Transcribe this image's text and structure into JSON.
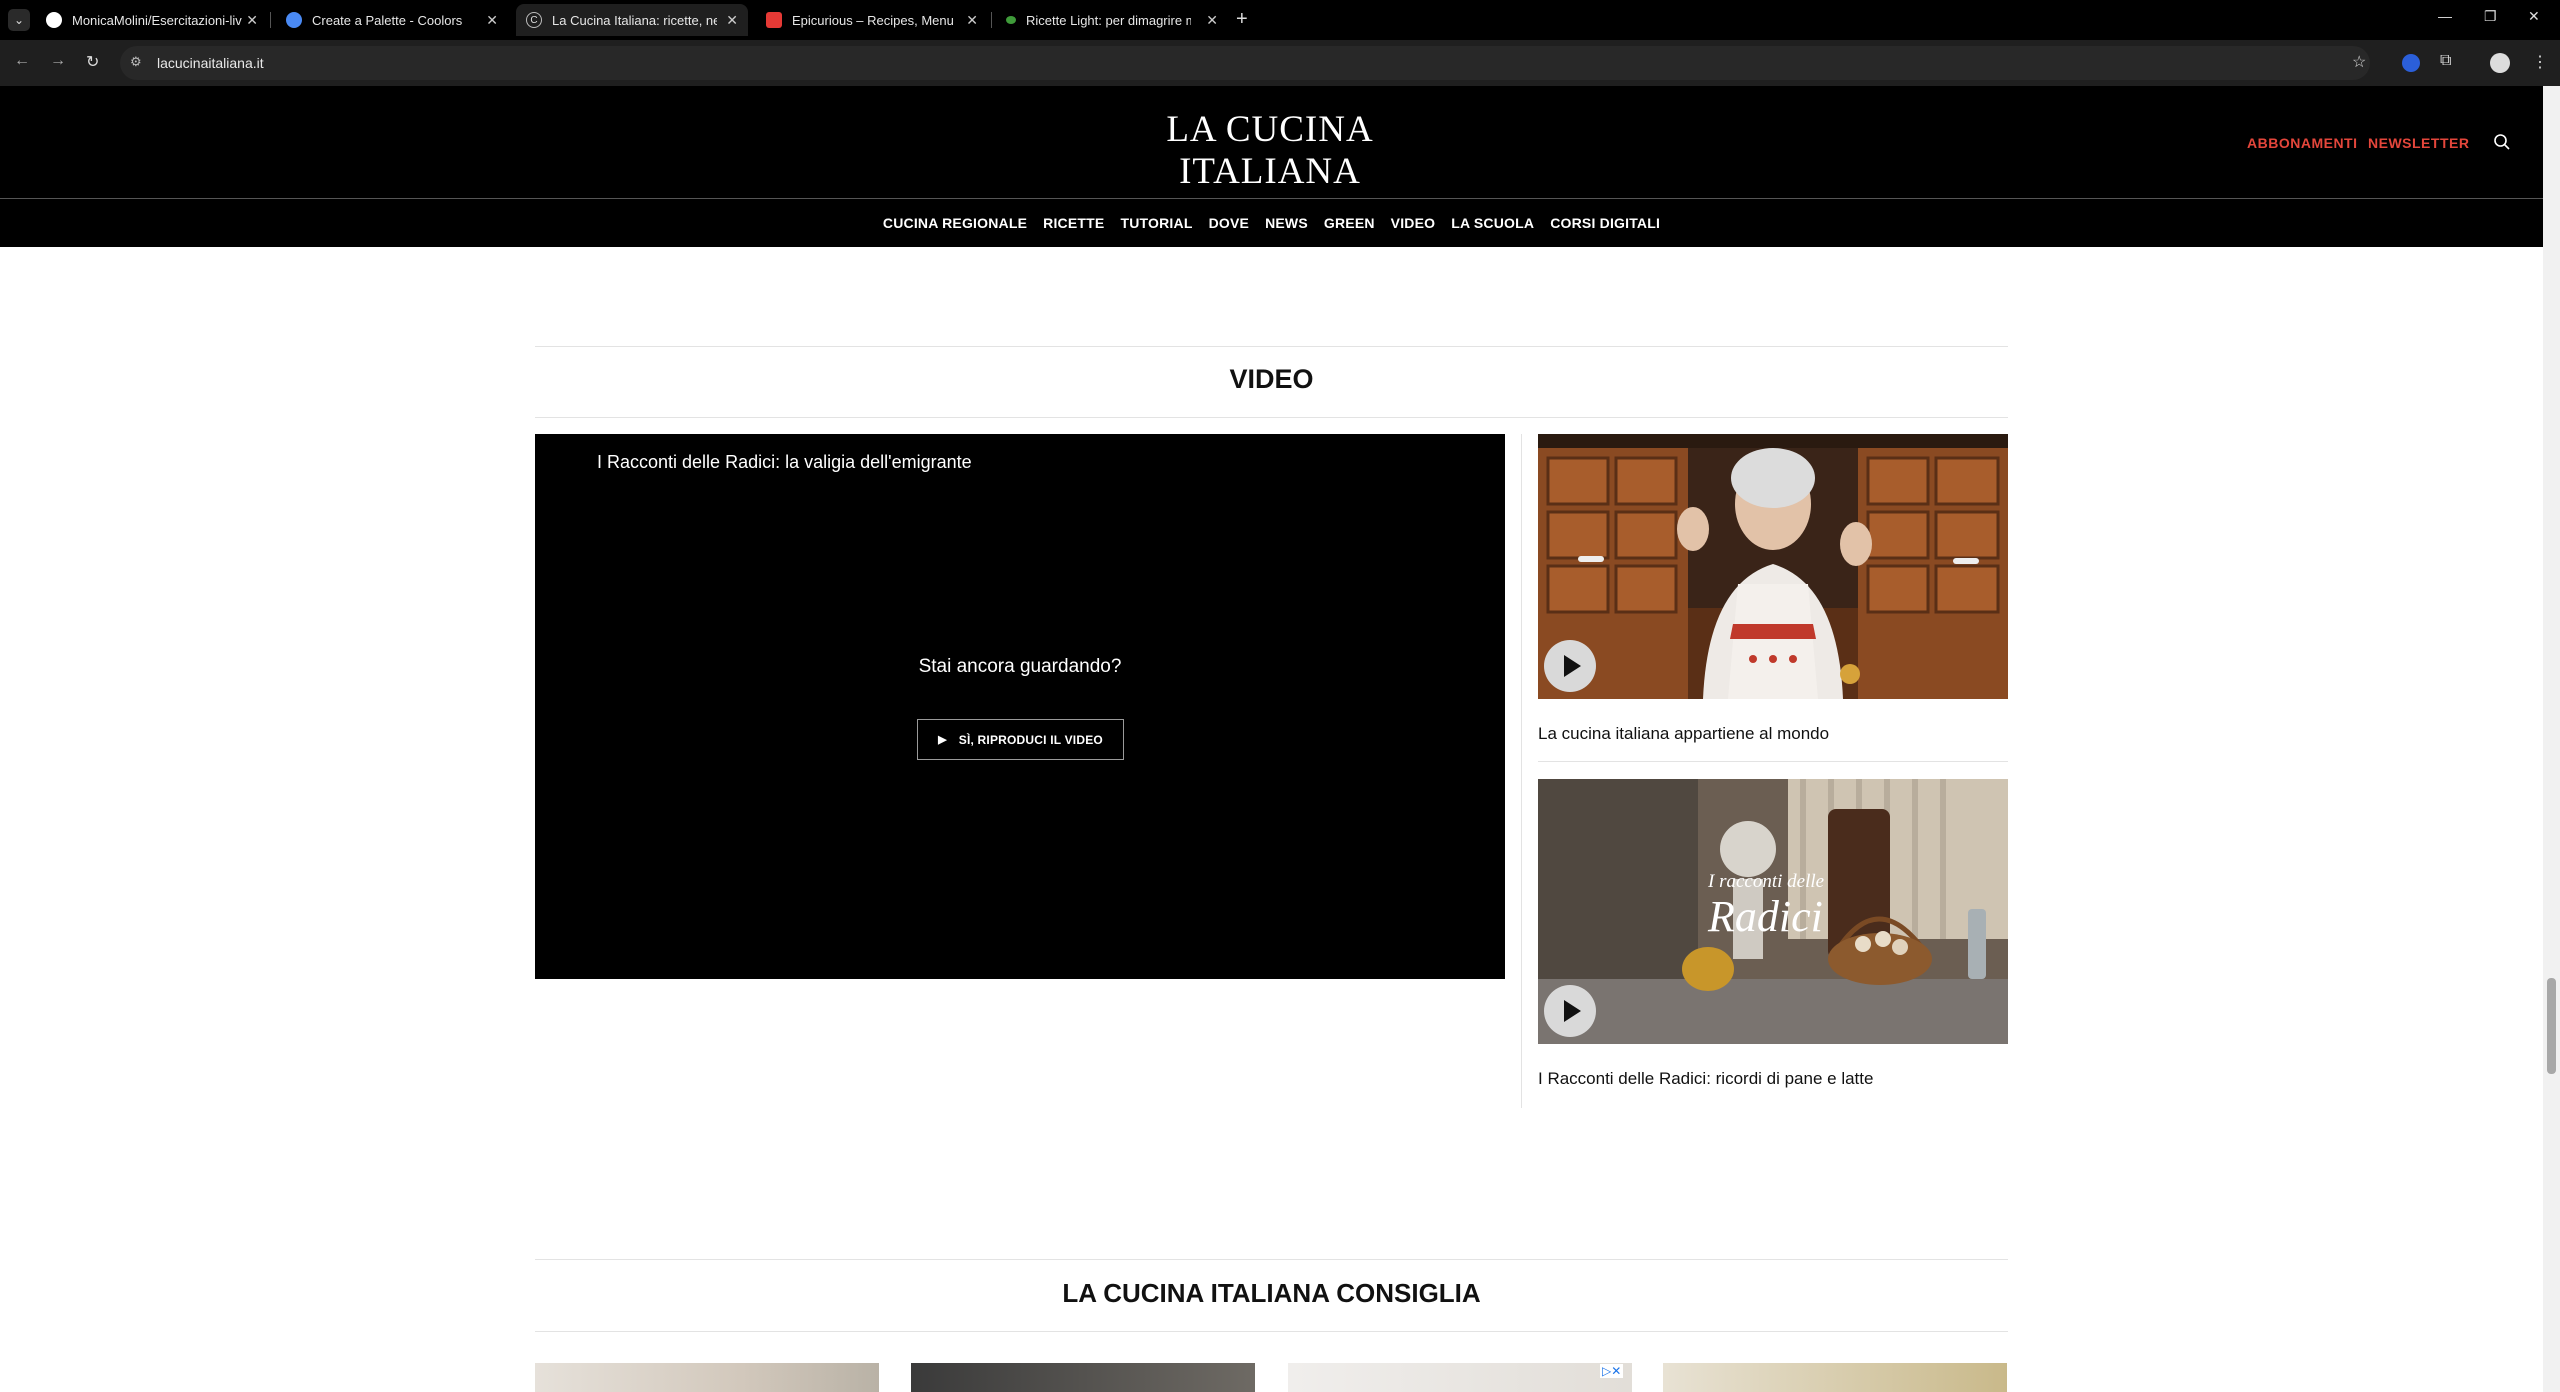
{
  "browser": {
    "tabs": [
      {
        "title": "MonicaMolini/Esercitazioni-live",
        "favicon": "github-icon"
      },
      {
        "title": "Create a Palette - Coolors",
        "favicon": "coolors-icon"
      },
      {
        "title": "La Cucina Italiana: ricette, news",
        "favicon": "lci-icon"
      },
      {
        "title": "Epicurious – Recipes, Menu Ide",
        "favicon": "epicurious-icon"
      },
      {
        "title": "Ricette Light: per dimagrire ma",
        "favicon": "leaf-icon"
      }
    ],
    "active_tab": 2,
    "url": "lacucinaitaliana.it"
  },
  "site": {
    "logo_line1": "LA CUCINA",
    "logo_line2": "ITALIANA",
    "header_links": [
      "ABBONAMENTI",
      "NEWSLETTER"
    ],
    "nav": [
      "CUCINA REGIONALE",
      "RICETTE",
      "TUTORIAL",
      "DOVE",
      "NEWS",
      "GREEN",
      "VIDEO",
      "LA SCUOLA",
      "CORSI DIGITALI"
    ],
    "accent_color": "#e4463b"
  },
  "video_section": {
    "title": "VIDEO",
    "player": {
      "title": "I Racconti delle Radici: la valigia dell'emigrante",
      "prompt": "Stai ancora guardando?",
      "replay_label": "SÌ, RIPRODUCI IL VIDEO"
    },
    "side_videos": [
      {
        "caption": "La cucina italiana appartiene al mondo"
      },
      {
        "caption": "I Racconti delle Radici: ricordi di pane e latte",
        "overlay_line1": "I racconti delle",
        "overlay_line2": "Radici"
      }
    ]
  },
  "recommend_section": {
    "title": "LA CUCINA ITALIANA CONSIGLIA"
  }
}
